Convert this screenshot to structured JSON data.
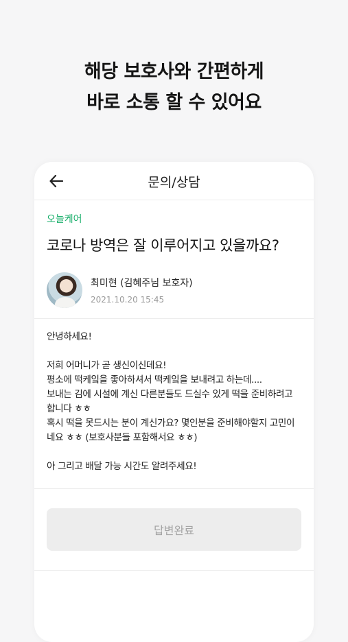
{
  "headline": {
    "line1": "해당 보호사와 간편하게",
    "line2": "바로 소통 할 수 있어요"
  },
  "nav": {
    "title": "문의/상담",
    "back_icon": "arrow-left-icon"
  },
  "post": {
    "brand": "오늘케어",
    "title": "코로나 방역은 잘 이루어지고 있을까요?",
    "author": {
      "name": "최미현 (김혜주님 보호자)",
      "date": "2021.10.20 15:45"
    },
    "body": "안녕하세요!\n\n저희 어머니가 곧 생신이신데요!\n평소에 떡케잌을 좋아하셔서 떡케잌을 보내려고 하는데....\n보내는 김에 시설에 계신 다른분들도 드실수 있게 떡을 준비하려고 합니다 ㅎㅎ\n혹시 떡을 못드시는 분이 계신가요? 몇인분을 준비해야할지 고민이네요 ㅎㅎ (보호사분들 포함해서요 ㅎㅎ)\n\n아 그리고 배달 가능 시간도 알려주세요!"
  },
  "actions": {
    "done_label": "답변완료"
  },
  "colors": {
    "brand": "#1aaf6b",
    "background": "#f6f6f7",
    "button_bg": "#ededed",
    "button_text": "#a4a4a4"
  }
}
